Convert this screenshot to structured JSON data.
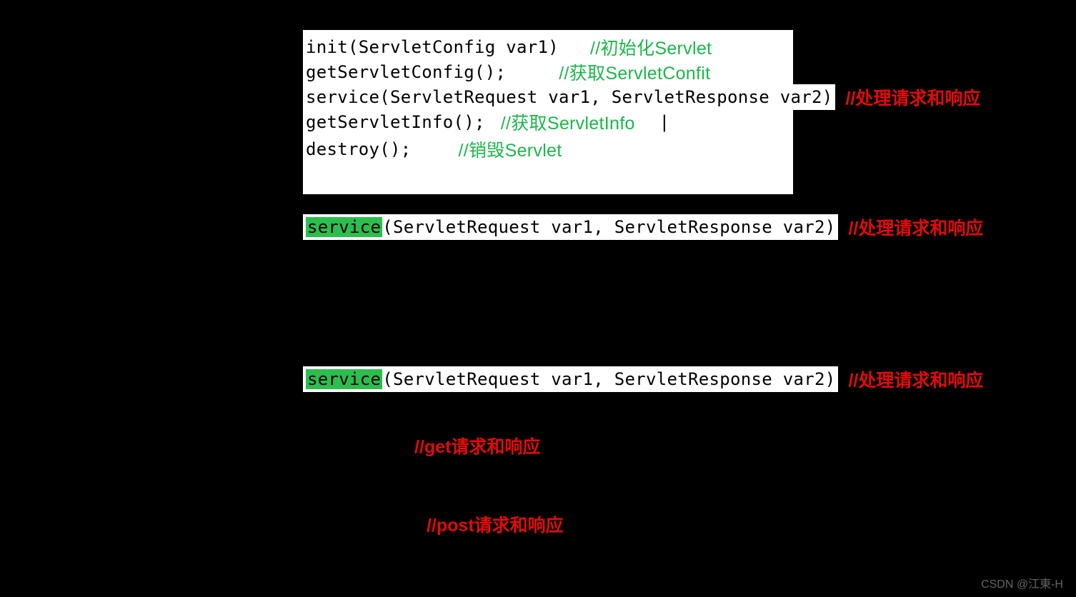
{
  "rows": {
    "r1": {
      "code": "init(ServletConfig var1)",
      "ann": "//初始化Servlet"
    },
    "r2": {
      "code": "getServletConfig();",
      "ann": "//获取ServletConfit"
    },
    "r3": {
      "code": "service(ServletRequest var1, ServletResponse var2)",
      "ann": "//处理请求和响应"
    },
    "r4": {
      "pre": "getServletInfo();",
      "ann": "//获取ServletInfo",
      "post": "|"
    },
    "r5": {
      "code": "destroy();",
      "ann": "//销毁Servlet"
    },
    "r6": {
      "service_hi": "service",
      "service_rest": "(ServletRequest var1, ServletResponse var2)",
      "ann": "//处理请求和响应"
    },
    "r7": {
      "service_hi": "service",
      "service_rest": "(ServletRequest var1, ServletResponse var2)",
      "ann": "//处理请求和响应"
    },
    "r8": {
      "ann": "//get请求和响应"
    },
    "r9": {
      "ann": "//post请求和响应"
    }
  },
  "watermark": "CSDN @江東-H"
}
